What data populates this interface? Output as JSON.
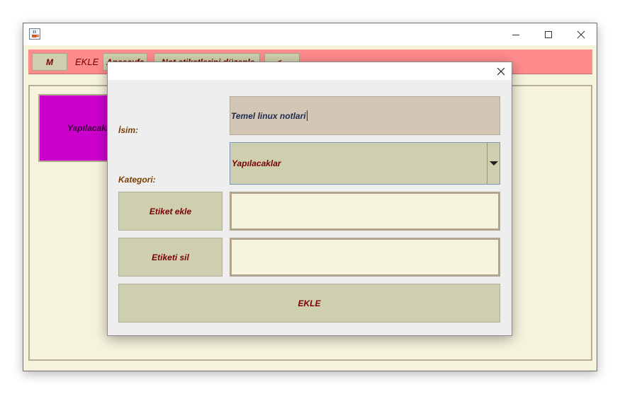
{
  "window": {
    "icon": "java-cup-icon",
    "controls": {
      "minimize": "minimize-icon",
      "maximize": "maximize-icon",
      "close": "close-icon"
    }
  },
  "toolbar": {
    "m_button": "M",
    "ekle_label": "EKLE",
    "anasayfa_button": "Anasayfa",
    "edit_tags_button": "Not etiketlerini düzenle",
    "back_button": "<--"
  },
  "content": {
    "category_tile": "Yapılacaklar"
  },
  "dialog": {
    "close": "close-icon",
    "isim_label": "İsim:",
    "isim_value": "Temel linux notlari",
    "kategori_label": "Kategori:",
    "kategori_value": "Yapılacaklar",
    "kategori_arrow": "dropdown-arrow-icon",
    "add_tag_button": "Etiket ekle",
    "add_tag_value": "",
    "remove_tag_button": "Etiketi sil",
    "remove_tag_value": "",
    "submit_button": "EKLE"
  },
  "colors": {
    "toolbar": "#ff8c8c",
    "window_bg": "#f5f3dc",
    "button_bg": "#cecfae",
    "text_dark_red": "#7a0000",
    "tile_magenta": "#cc00cc",
    "input_bg": "#d3c6b5"
  }
}
